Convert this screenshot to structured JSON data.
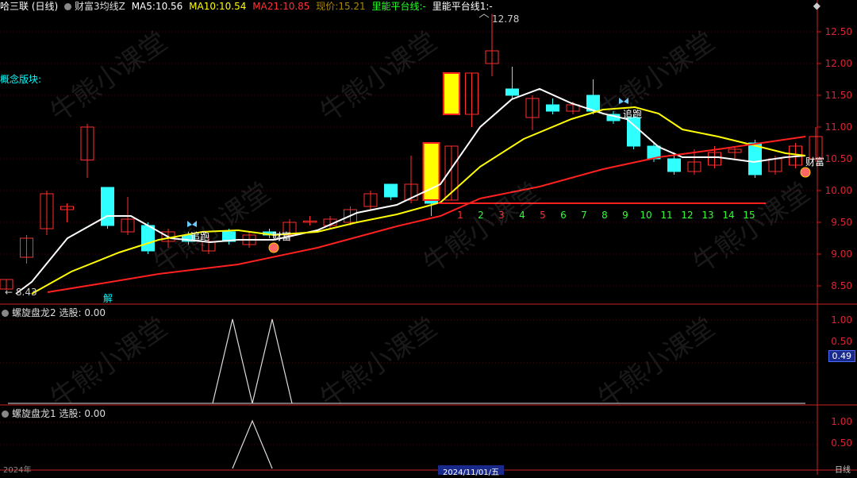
{
  "header": {
    "app": "哈三联 (日线)",
    "indicator": "财富3均线Z",
    "ma5_label": "MA5:",
    "ma5": "10.56",
    "ma10_label": "MA10:",
    "ma10": "10.54",
    "ma21_label": "MA21:",
    "ma21": "10.85",
    "price_label": "现价:",
    "price": "15.21",
    "platform_label": "里能平台线:",
    "platform_val": "-",
    "platform1_label": "里能平台线1:",
    "platform1_val": "-"
  },
  "concept_label": "概念版块:",
  "annotations": {
    "high_price": "12.78",
    "low_price": "8.43",
    "chase": "追跑",
    "chase2": "追跑",
    "wealth": "财富",
    "wealth2": "财富",
    "jie": "解"
  },
  "price_axis": [
    "12.50",
    "12.00",
    "11.50",
    "11.00",
    "10.50",
    "10.00",
    "9.50",
    "9.00",
    "8.50"
  ],
  "day_counts": [
    "1",
    "2",
    "3",
    "4",
    "5",
    "6",
    "7",
    "8",
    "9",
    "10",
    "11",
    "12",
    "13",
    "14",
    "15"
  ],
  "pane2": {
    "title": "螺旋盘龙2",
    "select_label": "选股:",
    "select_val": "0.00",
    "axis": [
      "1.00",
      "0.50"
    ],
    "badge": "0.49"
  },
  "pane3": {
    "title": "螺旋盘龙1",
    "select_label": "选股:",
    "select_val": "0.00",
    "axis": [
      "1.00",
      "0.50"
    ]
  },
  "bottom": {
    "date_left": "2024年",
    "date_mid": "2024/11/01/五",
    "date_right": "日线"
  },
  "watermark": "牛熊小课堂",
  "colors": {
    "up": "#ff3030",
    "down": "#30ffff",
    "ma5": "#ffffff",
    "ma10": "#ffff00",
    "ma21": "#ff2020",
    "limit": "#ffff00"
  }
}
